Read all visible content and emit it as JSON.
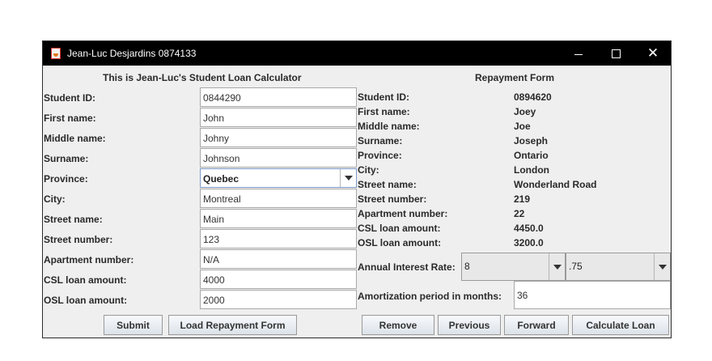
{
  "window": {
    "title": "Jean-Luc Desjardins 0874133",
    "minimize_icon": "minimize-icon",
    "maximize_icon": "maximize-icon",
    "close_symbol": "✕"
  },
  "left": {
    "heading": "This is Jean-Luc's Student Loan Calculator",
    "labels": {
      "student_id": "Student ID:",
      "first_name": "First name:",
      "middle_name": "Middle name:",
      "surname": "Surname:",
      "province": "Province:",
      "city": "City:",
      "street_name": "Street name:",
      "street_number": "Street number:",
      "apartment_number": "Apartment number:",
      "csl_loan": "CSL loan amount:",
      "osl_loan": "OSL loan amount:"
    },
    "values": {
      "student_id": "0844290",
      "first_name": "John",
      "middle_name": "Johny",
      "surname": "Johnson",
      "province": "Quebec",
      "city": "Montreal",
      "street_name": "Main",
      "street_number": "123",
      "apartment_number": "N/A",
      "csl_loan": "4000",
      "osl_loan": "2000"
    },
    "buttons": {
      "submit": "Submit",
      "load": "Load Repayment Form"
    }
  },
  "right": {
    "heading": "Repayment Form",
    "labels": {
      "student_id": "Student ID:",
      "first_name": "First name:",
      "middle_name": "Middle name:",
      "surname": "Surname:",
      "province": "Province:",
      "city": "City:",
      "street_name": "Street name:",
      "street_number": "Street number:",
      "apartment_number": "Apartment number:",
      "csl_loan": "CSL loan amount:",
      "osl_loan": "OSL loan amount:",
      "interest_rate": "Annual Interest Rate:",
      "amortization": "Amortization period in months:"
    },
    "values": {
      "student_id": "0894620",
      "first_name": "Joey",
      "middle_name": "Joe",
      "surname": "Joseph",
      "province": "Ontario",
      "city": "London",
      "street_name": "Wonderland Road",
      "street_number": "219",
      "apartment_number": "22",
      "csl_loan": "4450.0",
      "osl_loan": "3200.0",
      "rate_whole": "8",
      "rate_fraction": ".75",
      "amortization": "36"
    },
    "buttons": {
      "remove": "Remove",
      "previous": "Previous",
      "forward": "Forward",
      "calculate": "Calculate Loan"
    }
  }
}
